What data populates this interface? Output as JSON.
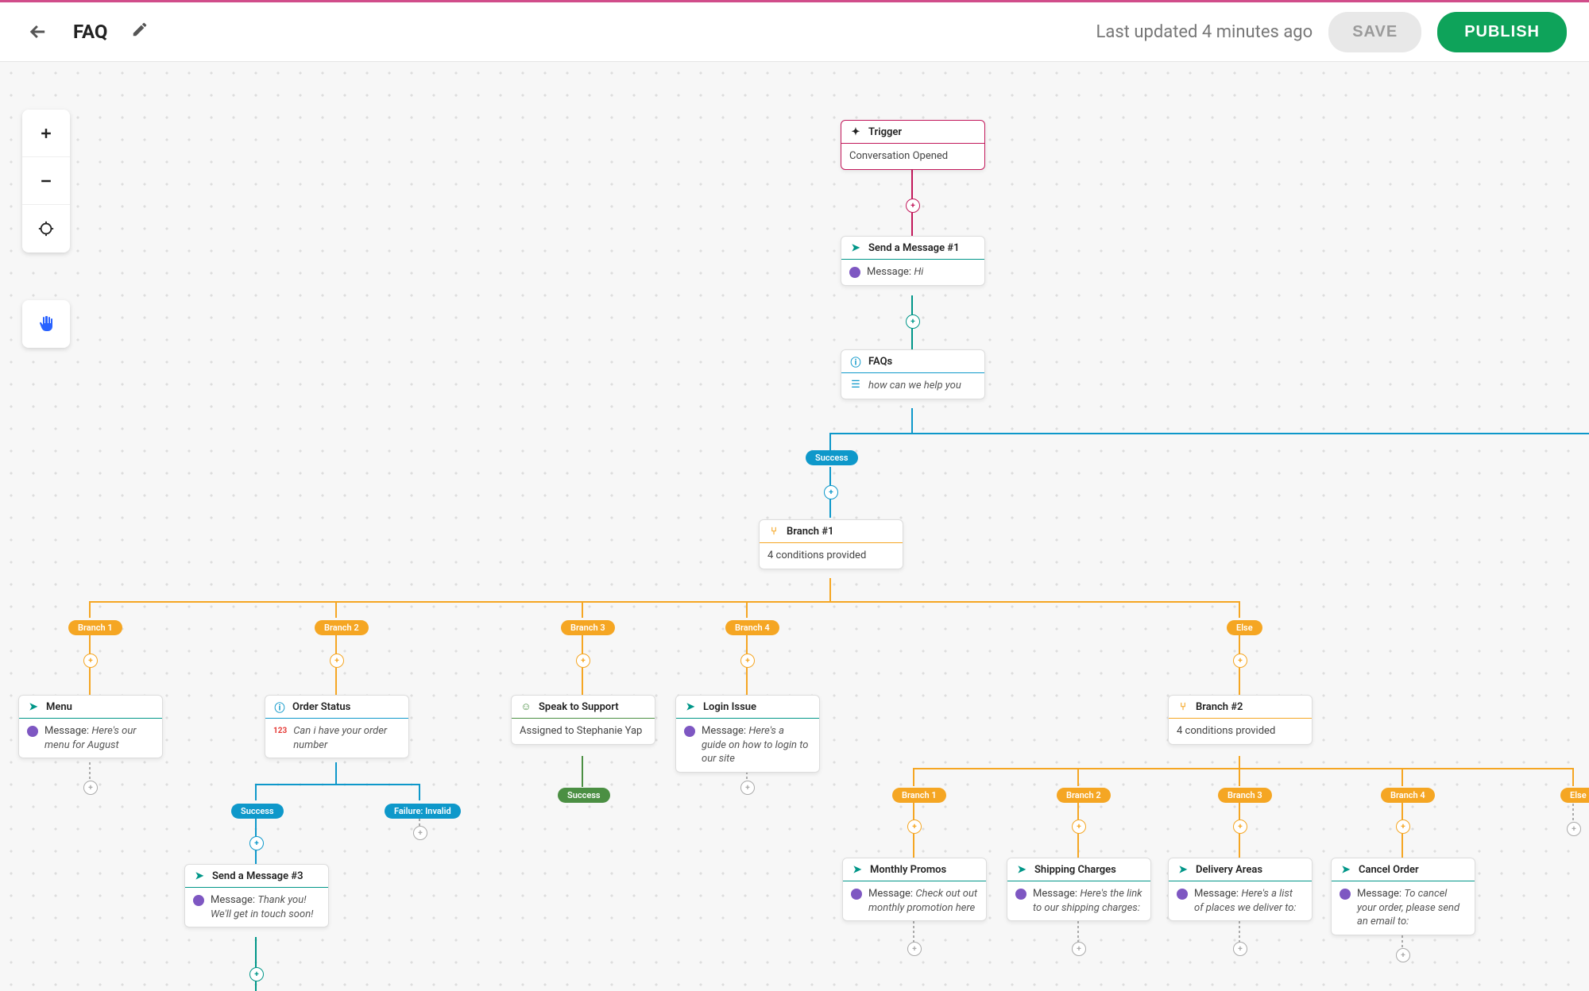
{
  "header": {
    "title": "FAQ",
    "last_updated": "Last updated 4 minutes ago",
    "save_label": "SAVE",
    "publish_label": "PUBLISH"
  },
  "colors": {
    "trigger": "#c2185b",
    "message": "#009688",
    "faq": "#0e98ca",
    "branch": "#f5a623",
    "support": "#4b8f43"
  },
  "nodes": {
    "trigger": {
      "title": "Trigger",
      "body": "Conversation Opened"
    },
    "send1": {
      "title": "Send a Message #1",
      "body_prefix": "Message: ",
      "body_value": "Hi"
    },
    "faqs": {
      "title": "FAQs",
      "body": "how can we help you"
    },
    "branch1": {
      "title": "Branch #1",
      "body": "4 conditions provided"
    },
    "menu": {
      "title": "Menu",
      "body_prefix": "Message: ",
      "body_value": "Here's our menu for August"
    },
    "order": {
      "title": "Order Status",
      "body": "Can i have your order number"
    },
    "support": {
      "title": "Speak to Support",
      "body": "Assigned to Stephanie Yap"
    },
    "login": {
      "title": "Login Issue",
      "body_prefix": "Message: ",
      "body_value": "Here's a guide on how to login to our site"
    },
    "branch2": {
      "title": "Branch #2",
      "body": "4 conditions provided"
    },
    "send3": {
      "title": "Send a Message #3",
      "body_prefix": "Message: ",
      "body_value": "Thank you! We'll get in touch soon!"
    },
    "promos": {
      "title": "Monthly Promos",
      "body_prefix": "Message: ",
      "body_value": "Check out out monthly promotion here"
    },
    "shipping": {
      "title": "Shipping Charges",
      "body_prefix": "Message: ",
      "body_value": "Here's the link to our shipping charges:"
    },
    "delivery": {
      "title": "Delivery Areas",
      "body_prefix": "Message: ",
      "body_value": "Here's a list of places we deliver to:"
    },
    "cancel": {
      "title": "Cancel Order",
      "body_prefix": "Message: ",
      "body_value": "To cancel your order, please send an email to:"
    }
  },
  "pills": {
    "success": "Success",
    "failure": "Failure: Invalid",
    "b1": "Branch 1",
    "b2": "Branch 2",
    "b3": "Branch 3",
    "b4": "Branch 4",
    "else": "Else"
  }
}
